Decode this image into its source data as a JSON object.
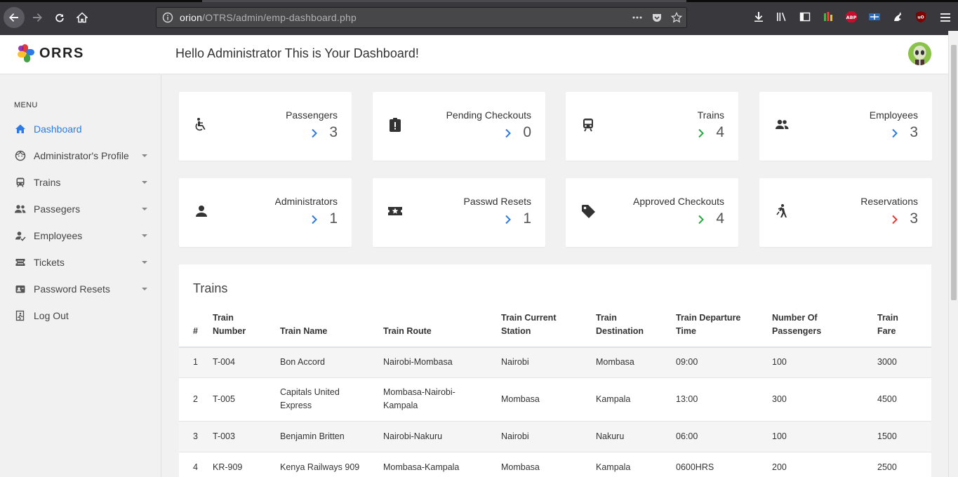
{
  "browser": {
    "url_host": "orion",
    "url_path": "/OTRS/admin/emp-dashboard.php"
  },
  "header": {
    "logo_text": "ORRS",
    "greeting": "Hello Administrator This is Your Dashboard!"
  },
  "sidebar": {
    "menu_label": "MENU",
    "items": [
      {
        "label": "Dashboard",
        "icon": "home-icon"
      },
      {
        "label": "Administrator's Profile",
        "icon": "face-icon"
      },
      {
        "label": "Trains",
        "icon": "train-icon"
      },
      {
        "label": "Passegers",
        "icon": "people-icon"
      },
      {
        "label": "Employees",
        "icon": "employee-icon"
      },
      {
        "label": "Tickets",
        "icon": "ticket-icon"
      },
      {
        "label": "Password Resets",
        "icon": "badge-icon"
      },
      {
        "label": "Log Out",
        "icon": "exit-icon"
      }
    ]
  },
  "cards": [
    {
      "title": "Passengers",
      "value": "3",
      "icon": "accessible-icon",
      "chevron_color": "#2c7be5"
    },
    {
      "title": "Pending Checkouts",
      "value": "0",
      "icon": "clipboard-alert-icon",
      "chevron_color": "#2c7be5"
    },
    {
      "title": "Trains",
      "value": "4",
      "icon": "train-icon",
      "chevron_color": "#28a745"
    },
    {
      "title": "Employees",
      "value": "3",
      "icon": "people-icon",
      "chevron_color": "#2c7be5"
    },
    {
      "title": "Administrators",
      "value": "1",
      "icon": "person-icon",
      "chevron_color": "#2c7be5"
    },
    {
      "title": "Passwd Resets",
      "value": "1",
      "icon": "star-ticket-icon",
      "chevron_color": "#2c7be5"
    },
    {
      "title": "Approved Checkouts",
      "value": "4",
      "icon": "tag-icon",
      "chevron_color": "#28a745"
    },
    {
      "title": "Reservations",
      "value": "3",
      "icon": "walking-icon",
      "chevron_color": "#e53935"
    }
  ],
  "trains_table": {
    "title": "Trains",
    "headers": [
      "#",
      "Train Number",
      "Train Name",
      "Train Route",
      "Train Current Station",
      "Train Destination",
      "Train Departure Time",
      "Number Of Passengers",
      "Train Fare"
    ],
    "rows": [
      [
        "1",
        "T-004",
        "Bon Accord",
        "Nairobi-Mombasa",
        "Nairobi",
        "Mombasa",
        "09:00",
        "100",
        "3000"
      ],
      [
        "2",
        "T-005",
        "Capitals United Express",
        "Mombasa-Nairobi-Kampala",
        "Mombasa",
        "Kampala",
        "13:00",
        "300",
        "4500"
      ],
      [
        "3",
        "T-003",
        "Benjamin Britten",
        "Nairobi-Nakuru",
        "Nairobi",
        "Nakuru",
        "06:00",
        "100",
        "1500"
      ],
      [
        "4",
        "KR-909",
        "Kenya Railways 909",
        "Mombasa-Kampala",
        "Mombasa",
        "Kampala",
        "0600HRS",
        "200",
        "2500"
      ]
    ]
  }
}
